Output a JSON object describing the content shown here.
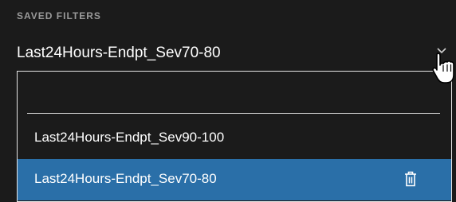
{
  "saved_filters": {
    "label": "SAVED FILTERS",
    "selected_value": "Last24Hours-Endpt_Sev70-80",
    "search_placeholder": "",
    "options": [
      {
        "label": "Last24Hours-Endpt_Sev90-100",
        "highlighted": false
      },
      {
        "label": "Last24Hours-Endpt_Sev70-80",
        "highlighted": true,
        "icon": "trash-icon"
      }
    ]
  },
  "colors": {
    "background": "#1b1b1b",
    "label": "#9a9a9a",
    "text": "#ffffff",
    "highlight": "#2a6fa8",
    "border": "#e6e6e6"
  }
}
